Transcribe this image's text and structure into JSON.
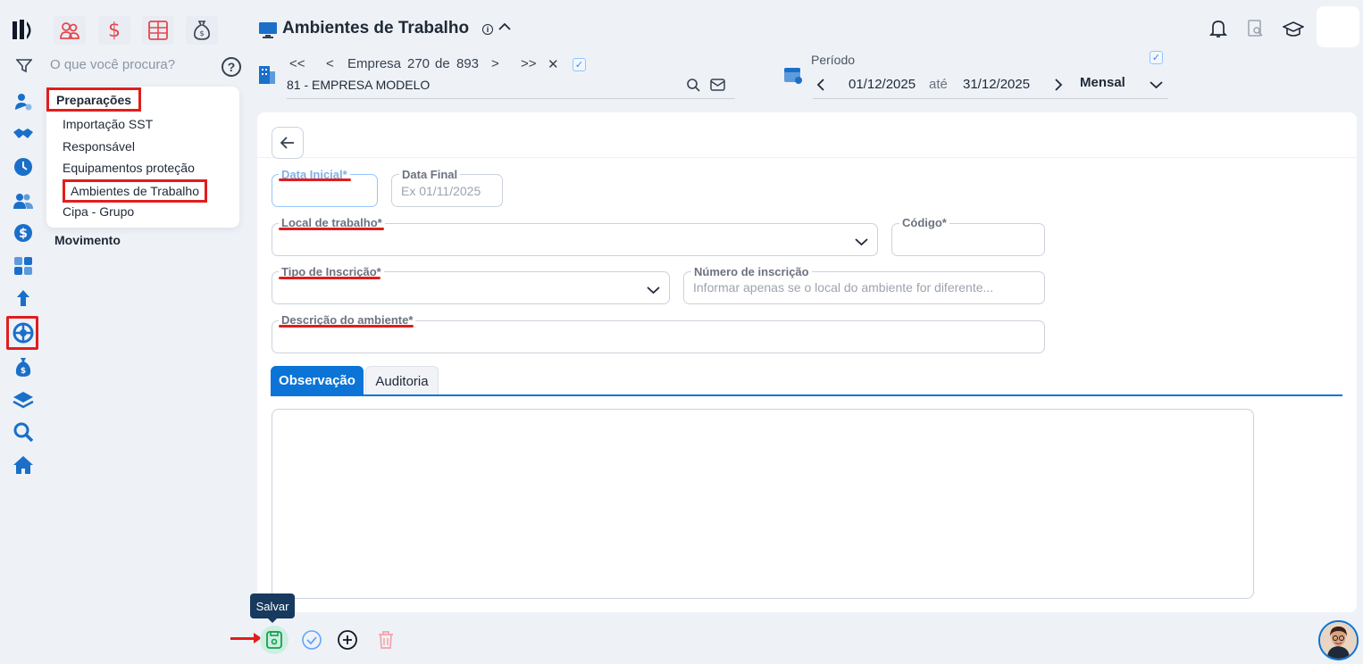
{
  "app": {
    "title": "Ambientes de Trabalho"
  },
  "search": {
    "placeholder": "O que você procura?",
    "help": "?"
  },
  "menu": {
    "section_title": "Preparações",
    "items": [
      {
        "label": "Importação SST"
      },
      {
        "label": "Responsável"
      },
      {
        "label": "Equipamentos proteção"
      },
      {
        "label": "Ambientes de Trabalho"
      },
      {
        "label": "Cipa - Grupo"
      }
    ],
    "next_section": "Movimento"
  },
  "empresa": {
    "first": "<<",
    "prev": "<",
    "label": "Empresa",
    "current": "270",
    "of": "de",
    "total": "893",
    "next": ">",
    "last": ">>",
    "close": "✕",
    "name": "81 - EMPRESA MODELO"
  },
  "periodo": {
    "label": "Período",
    "start": "01/12/2025",
    "ate": "até",
    "end": "31/12/2025",
    "mode": "Mensal"
  },
  "form": {
    "data_inicial": {
      "label": "Data Inicial*",
      "value": ""
    },
    "data_final": {
      "label": "Data Final",
      "placeholder": "Ex 01/11/2025"
    },
    "local_trabalho": {
      "label": "Local de trabalho*"
    },
    "codigo": {
      "label": "Código*"
    },
    "tipo_inscricao": {
      "label": "Tipo de Inscrição*"
    },
    "numero_inscricao": {
      "label": "Número de inscrição",
      "placeholder": "Informar apenas se o local do ambiente for diferente..."
    },
    "descricao": {
      "label": "Descrição do ambiente*"
    }
  },
  "tabs": [
    {
      "label": "Observação",
      "active": true
    },
    {
      "label": "Auditoria",
      "active": false
    }
  ],
  "toolbar": {
    "tooltip": "Salvar"
  },
  "colors": {
    "accent": "#0b74d6",
    "highlight": "#e11d1d",
    "save_bg": "#cdeee0",
    "tooltip_bg": "#173a5e"
  },
  "icons": {
    "rail": [
      "logo-icon",
      "filter-icon",
      "user-gear-icon",
      "handshake-icon",
      "clock-icon",
      "users-icon",
      "dollar-icon",
      "calculator-icon",
      "upload-icon",
      "settings-cog-icon",
      "money-bag-icon",
      "layers-icon",
      "search-icon",
      "home-icon"
    ],
    "top_modules": [
      "people-icon",
      "dollar-icon",
      "spreadsheet-icon",
      "money-bag-icon"
    ],
    "header_right": [
      "bell-icon",
      "document-search-icon",
      "graduation-cap-icon"
    ]
  }
}
